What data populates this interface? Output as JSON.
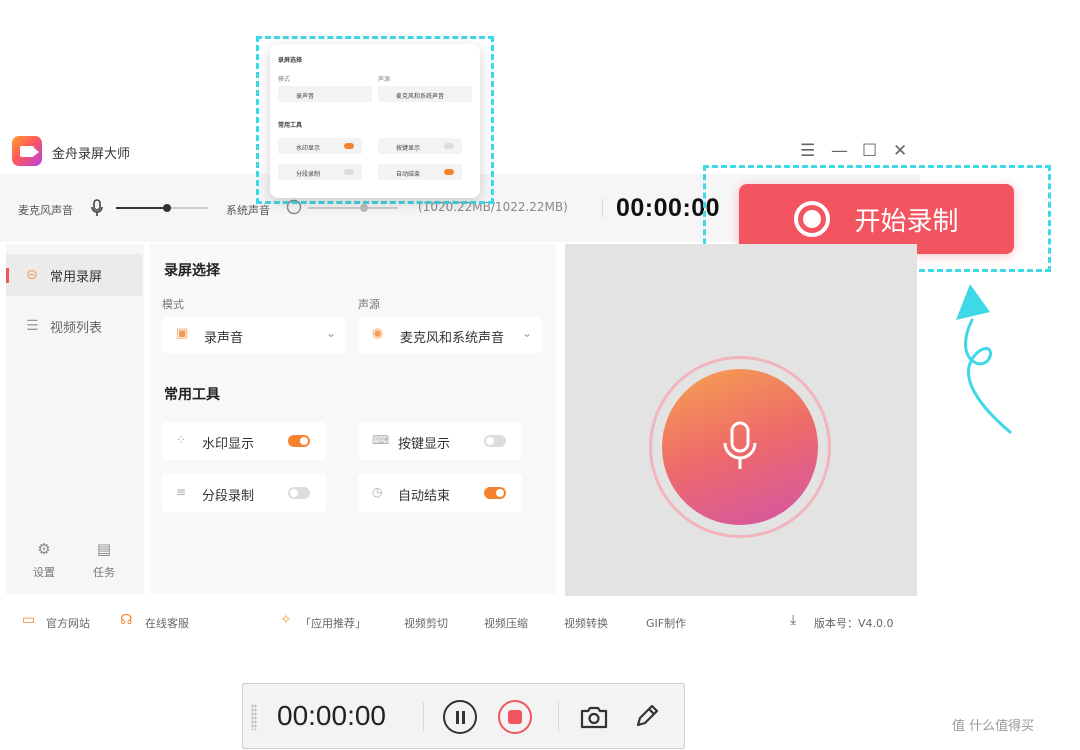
{
  "app": {
    "title": "金舟录屏大师"
  },
  "window_controls": {
    "menu": "☰",
    "minimize": "—",
    "maximize": "☐",
    "close": "✕"
  },
  "volume": {
    "mic_label": "麦克风声音",
    "mic_level": 0.55,
    "system_label": "系统声音",
    "system_level": 0.5,
    "storage": "(1020.22MB/1022.22MB)",
    "timer": "00:00:00"
  },
  "record": {
    "start_label": "开始录制"
  },
  "sidebar": {
    "items": [
      {
        "label": "常用录屏",
        "active": true
      },
      {
        "label": "视频列表",
        "active": false
      }
    ],
    "footer": [
      {
        "label": "设置",
        "icon": "gear-icon"
      },
      {
        "label": "任务",
        "icon": "task-icon"
      }
    ]
  },
  "settings": {
    "section_record": "录屏选择",
    "mode_label": "模式",
    "mode_value": "录声音",
    "source_label": "声源",
    "source_value": "麦克风和系统声音",
    "section_tools": "常用工具",
    "tools": [
      {
        "label": "水印显示",
        "on": true
      },
      {
        "label": "按键显示",
        "on": false
      },
      {
        "label": "分段录制",
        "on": false
      },
      {
        "label": "自动结束",
        "on": true
      }
    ]
  },
  "footer": {
    "official_site": "官方网站",
    "online_service": "在线客服",
    "recommend": "「应用推荐」",
    "video_cut": "视频剪切",
    "video_compress": "视频压缩",
    "video_convert": "视频转换",
    "gif_make": "GIF制作",
    "version": "版本号：V4.0.0"
  },
  "mini_panel": {
    "section_record": "录屏选择",
    "mode_label": "模式",
    "mode_value": "录声音",
    "source_label": "声源",
    "source_value": "麦克风和系统声音",
    "section_tools": "常用工具",
    "tools": [
      {
        "label": "水印显示",
        "on": true
      },
      {
        "label": "按键显示",
        "on": false
      },
      {
        "label": "分段录制",
        "on": false
      },
      {
        "label": "自动结束",
        "on": true
      }
    ]
  },
  "float_toolbar": {
    "timer": "00:00:00"
  },
  "watermark": "值 什么值得买",
  "colors": {
    "accent": "#f25460",
    "orange": "#f5822e",
    "highlight": "#3ed8e6"
  }
}
